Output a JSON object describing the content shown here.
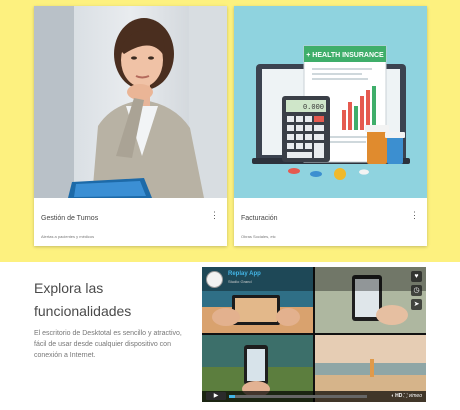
{
  "cards": [
    {
      "title": "Gestión de Turnos",
      "subtitle": "Alertas a pacientes y médicos"
    },
    {
      "title": "Facturación",
      "subtitle": "Obras Sociales, etc"
    }
  ],
  "illustration": {
    "banner": "+ HEALTH INSURANCE",
    "calculator_display": "0.000"
  },
  "section": {
    "heading": "Explora las funcionalidades",
    "description": "El escritorio de Desktotal es sencillo y atractivo, fácil de usar desde cualquier dispositivo con conexión a Internet."
  },
  "video": {
    "title": "Replay App",
    "author": "Studio Grand",
    "progress": 0.04,
    "hd": "HD",
    "brand": "vimeo"
  },
  "colors": {
    "band": "#fdf17f",
    "accent": "#43b5e6"
  },
  "icons": [
    "more-vert-icon",
    "heart-icon",
    "clock-icon",
    "send-icon",
    "play-icon",
    "fullscreen-icon",
    "volume-icon"
  ]
}
